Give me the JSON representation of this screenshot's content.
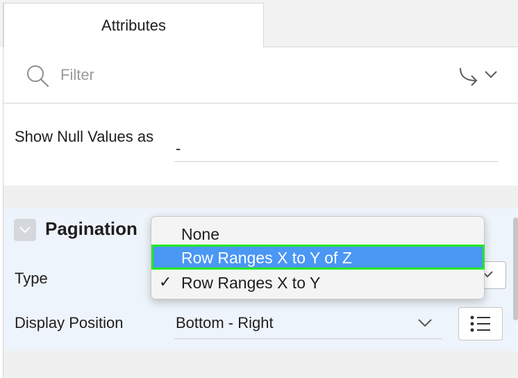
{
  "tabs": {
    "active_label": "Attributes"
  },
  "filter": {
    "placeholder": "Filter"
  },
  "null_values": {
    "label": "Show Null Values as",
    "value": "-"
  },
  "pagination": {
    "title": "Pagination",
    "type_label": "Type",
    "display_position_label": "Display Position",
    "display_position_value": "Bottom - Right"
  },
  "dropdown": {
    "options": [
      {
        "label": "None",
        "checked": false,
        "highlighted": false
      },
      {
        "label": "Row Ranges X to Y of Z",
        "checked": false,
        "highlighted": true
      },
      {
        "label": "Row Ranges X to Y",
        "checked": true,
        "highlighted": false
      }
    ],
    "check_glyph": "✓"
  },
  "icons": {
    "search": "search-icon",
    "goto": "goto-arrow-icon",
    "chevron": "chevron-down-icon",
    "list": "list-icon",
    "collapse": "collapse-chevron-icon"
  },
  "colors": {
    "highlight": "#4a97f4",
    "highlight_outline": "#22ea22",
    "section_bg": "#eef4fb"
  }
}
